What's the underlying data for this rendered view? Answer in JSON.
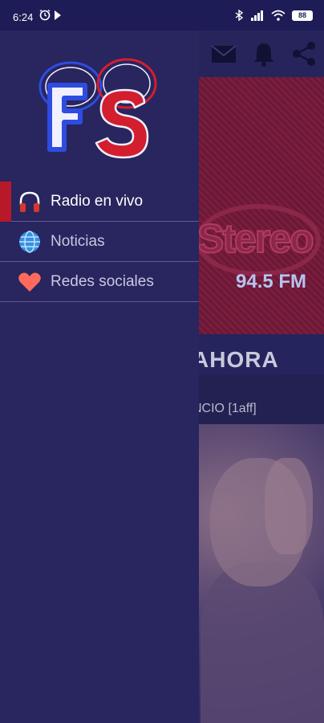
{
  "status_bar": {
    "time": "6:24",
    "battery": "88"
  },
  "drawer": {
    "logo_text": "FS",
    "items": [
      {
        "label": "Radio en vivo",
        "icon": "headphones-icon",
        "active": true
      },
      {
        "label": "Noticias",
        "icon": "globe-icon",
        "active": false
      },
      {
        "label": "Redes sociales",
        "icon": "heart-icon",
        "active": false
      }
    ]
  },
  "background": {
    "station_logo": "Stereo",
    "frequency": "94.5 FM",
    "now_playing_heading": "AHORA",
    "track": "NCIO [1aff]"
  },
  "colors": {
    "drawer_bg": "#28255f",
    "active_marker": "#b7192a",
    "logo_blue": "#2e4de0",
    "logo_red": "#d31e2e"
  }
}
